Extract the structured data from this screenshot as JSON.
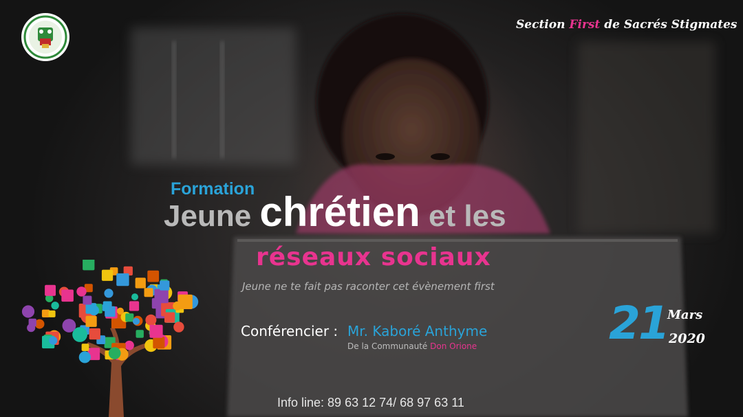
{
  "header": {
    "section_pre": "Section ",
    "section_highlight": "First",
    "section_post": " de Sacrés Stigmates"
  },
  "event": {
    "kicker": "Formation",
    "title_part1": "Jeune ",
    "title_part2": "chrétien",
    "title_part3": " et les",
    "subtitle": "réseaux sociaux",
    "tagline": "Jeune ne te fait pas raconter cet évènement first"
  },
  "speaker": {
    "label": "Conférencier :",
    "name": "Mr. Kaboré Anthyme",
    "community_prefix": "De la Communauté ",
    "community_name": "Don Orione"
  },
  "date": {
    "day": "21",
    "month": "Mars",
    "year": "2020"
  },
  "contact": {
    "info_line": "Info line: 89 63 12 74/  68 97 63 11"
  },
  "colors": {
    "accent_blue": "#2aa3d8",
    "accent_pink": "#e8348f",
    "background": "#1c1c1c",
    "text_white": "#ffffff"
  },
  "icons": {
    "logo": "association-emblem-icon",
    "tree": "social-media-tree-icon"
  }
}
